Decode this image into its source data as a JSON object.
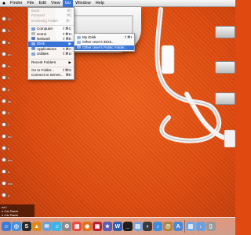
{
  "menubar": {
    "apple_icon": "apple-icon",
    "items": [
      {
        "label": "Finder"
      },
      {
        "label": "File"
      },
      {
        "label": "Edit"
      },
      {
        "label": "View"
      },
      {
        "label": "Go",
        "active": true
      },
      {
        "label": "Window"
      },
      {
        "label": "Help"
      }
    ],
    "clock": ""
  },
  "go_menu": {
    "items": [
      {
        "label": "Back",
        "shortcut": "⌘[",
        "disabled": true,
        "icon": ""
      },
      {
        "label": "Forward",
        "shortcut": "⌘]",
        "disabled": true,
        "icon": ""
      },
      {
        "label": "Enclosing Folder",
        "shortcut": "⌘↑",
        "disabled": true,
        "icon": ""
      },
      {
        "label": "Computer",
        "shortcut": "⇧⌘C",
        "disabled": false,
        "icon": "computer-icon",
        "color": "#7a9fd0"
      },
      {
        "label": "Home",
        "shortcut": "⇧⌘H",
        "disabled": false,
        "icon": "home-icon",
        "color": "#b9b9b9"
      },
      {
        "label": "Network",
        "shortcut": "⇧⌘K",
        "disabled": false,
        "icon": "network-icon",
        "color": "#5d7fc4"
      },
      {
        "label": "iDisk",
        "shortcut": "▶",
        "disabled": false,
        "highlighted": true,
        "icon": "idisk-icon",
        "color": "#9ab6e4"
      },
      {
        "label": "Applications",
        "shortcut": "⇧⌘A",
        "disabled": false,
        "icon": "applications-icon",
        "color": "#6f8fc8"
      },
      {
        "label": "Utilities",
        "shortcut": "⇧⌘U",
        "disabled": false,
        "icon": "utilities-icon",
        "color": "#8aa4d4"
      },
      {
        "label": "Recent Folders",
        "shortcut": "▶",
        "disabled": false,
        "icon": ""
      },
      {
        "label": "Go to Folder...",
        "shortcut": "⇧⌘G",
        "disabled": false,
        "icon": ""
      },
      {
        "label": "Connect to Server...",
        "shortcut": "⌘K",
        "disabled": false,
        "icon": ""
      }
    ]
  },
  "idisk_submenu": {
    "items": [
      {
        "label": "My iDisk",
        "shortcut": "⇧⌘I",
        "highlighted": false
      },
      {
        "label": "Other User's iDisk...",
        "shortcut": "",
        "highlighted": false
      },
      {
        "label": "Other User's Public Folder...",
        "shortcut": "",
        "highlighted": true
      }
    ]
  },
  "left_strip": {
    "items": [
      {
        "label": "Di"
      },
      {
        "label": "Fi"
      },
      {
        "label": "st"
      },
      {
        "label": "au"
      },
      {
        "label": "m"
      },
      {
        "label": "ll"
      },
      {
        "label": "a"
      },
      {
        "label": "ds"
      },
      {
        "label": "S"
      },
      {
        "label": "f"
      },
      {
        "label": "nd"
      },
      {
        "label": "u"
      },
      {
        "label": "rks"
      },
      {
        "label": "a"
      },
      {
        "label": "rne"
      },
      {
        "label": "o"
      }
    ]
  },
  "corner_label": {
    "line1": "nd I",
    "line2": "o Car Racer",
    "line3": "o Car Racer"
  },
  "dock": {
    "items": [
      {
        "icon": "finder-icon",
        "color": "#3e7bd6",
        "glyph": "☺"
      },
      {
        "icon": "safari-icon",
        "color": "#4a90d9",
        "glyph": "◎"
      },
      {
        "icon": "stocks-widget-icon",
        "color": "#2b2b2b",
        "glyph": "S"
      },
      {
        "icon": "vlc-icon",
        "color": "#e08a1a",
        "glyph": "▲"
      },
      {
        "icon": "mail-icon",
        "color": "#6aa0d8",
        "glyph": "✉"
      },
      {
        "icon": "itunes-icon",
        "color": "#3cb4e6",
        "glyph": "♫"
      },
      {
        "icon": "system-preferences-icon",
        "color": "#8a8a8a",
        "glyph": "⚙"
      },
      {
        "icon": "ical-icon",
        "color": "#e84b3c",
        "glyph": "▦"
      },
      {
        "icon": "firefox-icon",
        "color": "#e0701a",
        "glyph": "◉"
      },
      {
        "icon": "photo-booth-icon",
        "color": "#b8202a",
        "glyph": "▣"
      },
      {
        "icon": "imovie-icon",
        "color": "#5a5ab8",
        "glyph": "★"
      },
      {
        "icon": "word-icon",
        "color": "#2b5fb5",
        "glyph": "W"
      },
      {
        "icon": "terminal-icon",
        "color": "#1d1d1d",
        "glyph": "_"
      },
      {
        "icon": "preview-icon",
        "color": "#7fa6d8",
        "glyph": "▤"
      },
      {
        "icon": "dashboard-icon",
        "color": "#3a3a3a",
        "glyph": "◐"
      },
      {
        "icon": "itunes-store-icon",
        "color": "#3d8de0",
        "glyph": "♪"
      },
      {
        "icon": "address-book-icon",
        "color": "#b0863f",
        "glyph": "@"
      },
      {
        "icon": "app-store-icon",
        "color": "#4d88d8",
        "glyph": "A"
      },
      {
        "icon": "documents-folder-icon",
        "color": "#7aa6e0",
        "glyph": "▥"
      },
      {
        "icon": "downloads-folder-icon",
        "color": "#6f9edc",
        "glyph": "↓"
      },
      {
        "icon": "trash-icon",
        "color": "#9a9a9a",
        "glyph": "▯"
      }
    ]
  },
  "desktop_icons": [
    {
      "label": "",
      "icon": "hard-drive-icon"
    },
    {
      "label": "",
      "icon": "hard-drive-icon"
    },
    {
      "label": "",
      "icon": "hard-drive-icon"
    }
  ]
}
